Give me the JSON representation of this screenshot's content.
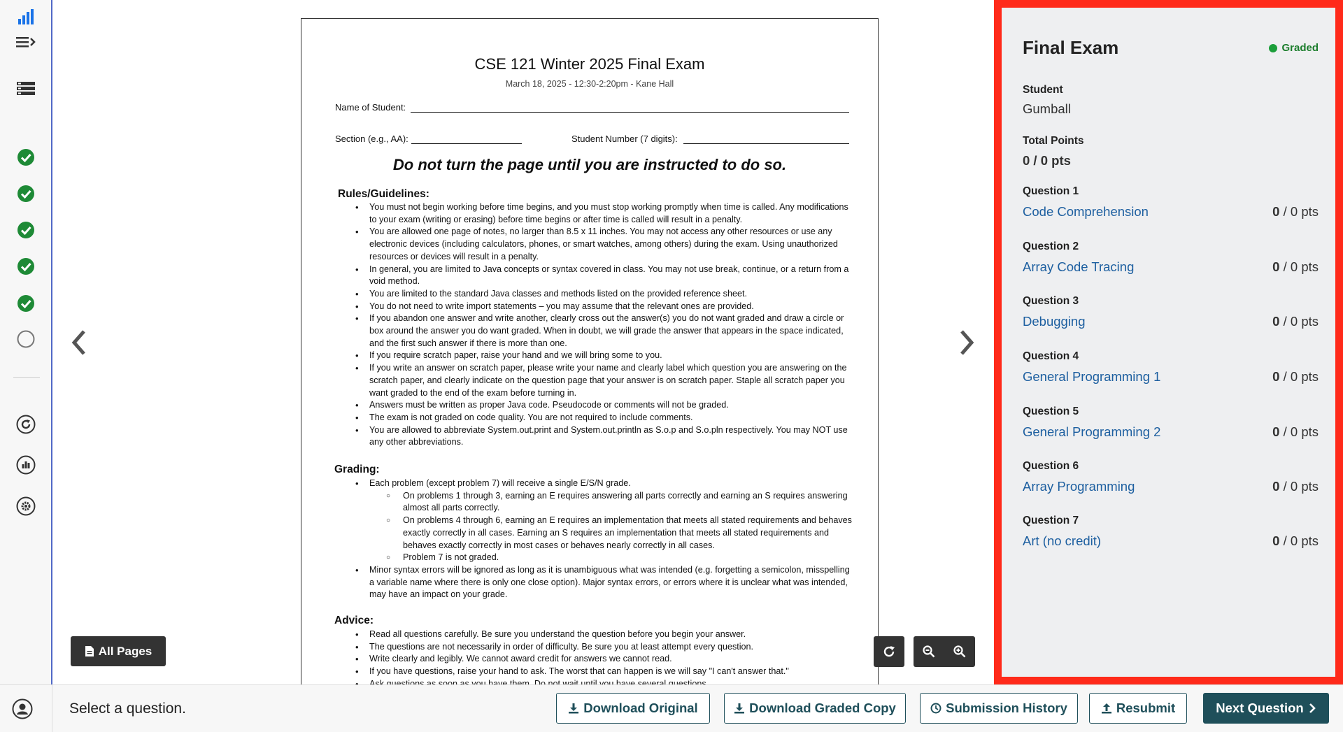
{
  "sidebar": {
    "icons": [
      "bar-chart-icon",
      "menu-expand-icon",
      "list-icon",
      "check-icon",
      "check-icon",
      "check-icon",
      "check-icon",
      "check-icon",
      "empty-circle-icon",
      "regrade-icon",
      "statistics-icon",
      "settings-icon"
    ],
    "accent": "#1a73e8",
    "check_color": "#1e8a36"
  },
  "document": {
    "title": "CSE 121 Winter 2025 Final Exam",
    "subtitle": "March 18, 2025 - 12:30-2:20pm - Kane Hall",
    "name_label": "Name of Student:",
    "section_label": "Section (e.g., AA):",
    "student_number_label": "Student Number (7 digits):",
    "warning": "Do not turn the page until you are instructed to do so.",
    "rules_heading": "Rules/Guidelines:",
    "rules": [
      "You must not begin working before time begins, and you must stop working promptly when time is called. Any modifications to your exam (writing or erasing) before time begins or after time is called will result in a penalty.",
      "You are allowed one page of notes, no larger than 8.5 x 11 inches. You may not access any other resources or use any electronic devices (including calculators, phones, or smart watches, among others) during the exam. Using unauthorized resources or devices will result in a penalty.",
      "In general, you are limited to Java concepts or syntax covered in class. You may not use break, continue, or a return from a void method.",
      "You are limited to the standard Java classes and methods listed on the provided reference sheet.",
      "You do not need to write import statements – you may assume that the relevant ones are provided.",
      "If you abandon one answer and write another, clearly cross out the answer(s) you do not want graded and draw a circle or box around the answer you do want graded. When in doubt, we will grade the answer that appears in the space indicated, and the first such answer if there is more than one.",
      "If you require scratch paper, raise your hand and we will bring some to you.",
      "If you write an answer on scratch paper, please write your name and clearly label which question you are answering on the scratch paper, and clearly indicate on the question page that your answer is on scratch paper. Staple all scratch paper you want graded to the end of the exam before turning in.",
      "Answers must be written as proper Java code. Pseudocode or comments will not be graded.",
      "The exam is not graded on code quality. You are not required to include comments.",
      "You are allowed to abbreviate System.out.print and System.out.println as S.o.p and S.o.pln respectively. You may NOT use any other abbreviations."
    ],
    "grading_heading": "Grading:",
    "grading": [
      {
        "text": "Each problem (except problem 7) will receive a single E/S/N grade.",
        "sub": false
      },
      {
        "text": "On problems 1 through 3, earning an E requires answering all parts correctly and earning an S requires answering almost all parts correctly.",
        "sub": true
      },
      {
        "text": "On problems 4 through 6, earning an E requires an implementation that meets all stated requirements and behaves exactly correctly in all cases. Earning an S requires an implementation that meets all stated requirements and behaves exactly correctly in most cases or behaves nearly correctly in all cases.",
        "sub": true
      },
      {
        "text": "Problem 7 is not graded.",
        "sub": true
      },
      {
        "text": "Minor syntax errors will be ignored as long as it is unambiguous what was intended (e.g. forgetting a semicolon, misspelling a variable name where there is only one close option). Major syntax errors, or errors where it is unclear what was intended, may have an impact on your grade.",
        "sub": false
      }
    ],
    "advice_heading": "Advice:",
    "advice": [
      "Read all questions carefully. Be sure you understand the question before you begin your answer.",
      "The questions are not necessarily in order of difficulty. Be sure you at least attempt every question.",
      "Write clearly and legibly. We cannot award credit for answers we cannot read.",
      "If you have questions, raise your hand to ask. The worst that can happen is we will say \"I can't answer that.\"",
      "Ask questions as soon as you have them. Do not wait until you have several questions."
    ]
  },
  "viewer": {
    "all_pages_label": "All Pages",
    "prev_icon": "chevron-left-icon",
    "next_icon": "chevron-right-icon",
    "rotate_icon": "rotate-icon",
    "zoom_out_icon": "zoom-out-icon",
    "zoom_in_icon": "zoom-in-icon"
  },
  "panel": {
    "title": "Final Exam",
    "status": "Graded",
    "status_color": "#1b9e3a",
    "highlight_color": "#ff2a1a",
    "student_label": "Student",
    "student_name": "Gumball",
    "total_label": "Total Points",
    "total_value": "0 / 0 pts",
    "questions": [
      {
        "label": "Question 1",
        "name": "Code Comprehension",
        "score": "0",
        "rest": " / 0 pts"
      },
      {
        "label": "Question 2",
        "name": "Array Code Tracing",
        "score": "0",
        "rest": " / 0 pts"
      },
      {
        "label": "Question 3",
        "name": "Debugging",
        "score": "0",
        "rest": " / 0 pts"
      },
      {
        "label": "Question 4",
        "name": "General Programming 1",
        "score": "0",
        "rest": " / 0 pts"
      },
      {
        "label": "Question 5",
        "name": "General Programming 2",
        "score": "0",
        "rest": " / 0 pts"
      },
      {
        "label": "Question 6",
        "name": "Array Programming",
        "score": "0",
        "rest": " / 0 pts"
      },
      {
        "label": "Question 7",
        "name": "Art (no credit)",
        "score": "0",
        "rest": " / 0 pts"
      }
    ]
  },
  "bottom": {
    "message": "Select a question.",
    "download_original": "Download Original",
    "download_graded": "Download Graded Copy",
    "submission_history": "Submission History",
    "resubmit": "Resubmit",
    "next_question": "Next Question"
  }
}
